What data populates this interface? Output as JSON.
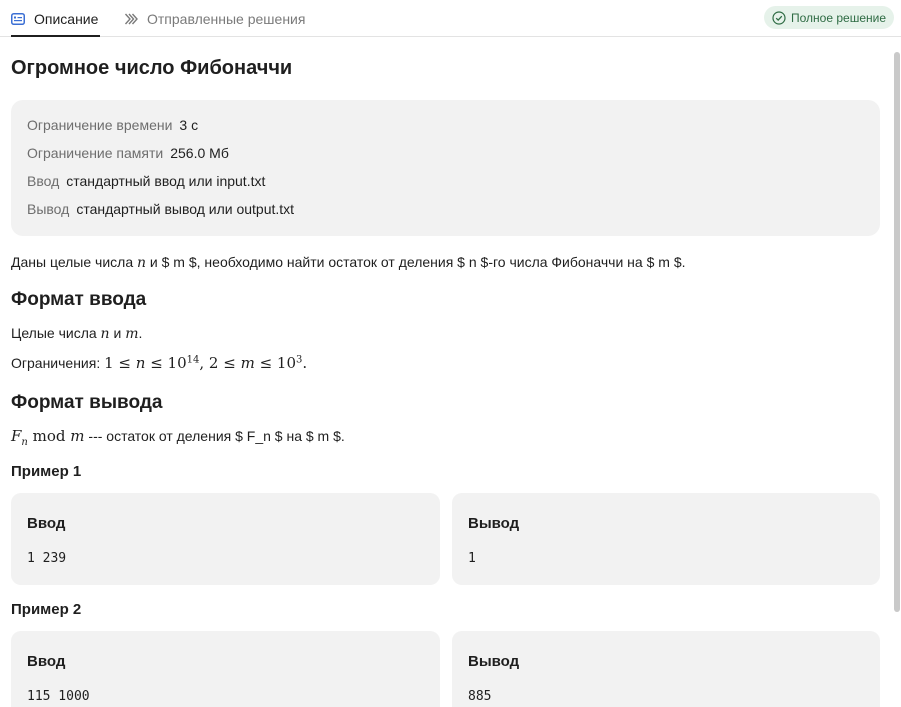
{
  "tabs": {
    "description": "Описание",
    "submissions": "Отправленные решения"
  },
  "status_badge": "Полное решение",
  "colors": {
    "badge_bg": "#e6f2ea",
    "badge_text": "#2e6b43",
    "panel_bg": "#f2f2f2",
    "tab_icon": "#3b6fd4"
  },
  "icons": {
    "description_tab": "list-card-icon",
    "submissions_tab": "double-chevron-icon",
    "status": "check-circle-icon"
  },
  "problem": {
    "title": "Огромное число Фибоначчи",
    "limits": [
      {
        "label": "Ограничение времени",
        "value": "3 с"
      },
      {
        "label": "Ограничение памяти",
        "value": "256.0 Мб"
      },
      {
        "label": "Ввод",
        "value": "стандартный ввод или input.txt"
      },
      {
        "label": "Вывод",
        "value": "стандартный вывод или output.txt"
      }
    ],
    "statement": {
      "t1": "Даны целые числа ",
      "n": "n",
      "t2": " и $ m $, необходимо найти остаток от деления $ n $-го числа Фибоначчи на $ m $."
    },
    "input_format": {
      "heading": "Формат ввода",
      "line1_text": "Целые числа ",
      "line1_n": "n",
      "line1_and": " и ",
      "line1_m": "m",
      "line1_end": ".",
      "line2_text": "Ограничения: ",
      "line2_math_a": "1 ≤ ",
      "line2_n": "n",
      "line2_math_b": " ≤ 10",
      "line2_exp1": "14",
      "line2_math_c": ", 2 ≤ ",
      "line2_m": "m",
      "line2_math_d": " ≤ 10",
      "line2_exp2": "3",
      "line2_end": "."
    },
    "output_format": {
      "heading": "Формат вывода",
      "f": "F",
      "f_sub": "n",
      "mod": " mod ",
      "m": "m",
      "rest": " --- остаток от деления $ F_n $ на $ m $."
    },
    "examples": [
      {
        "title": "Пример 1",
        "input_label": "Ввод",
        "input": "1 239",
        "output_label": "Вывод",
        "output": "1"
      },
      {
        "title": "Пример 2",
        "input_label": "Ввод",
        "input": "115 1000",
        "output_label": "Вывод",
        "output": "885"
      }
    ]
  }
}
